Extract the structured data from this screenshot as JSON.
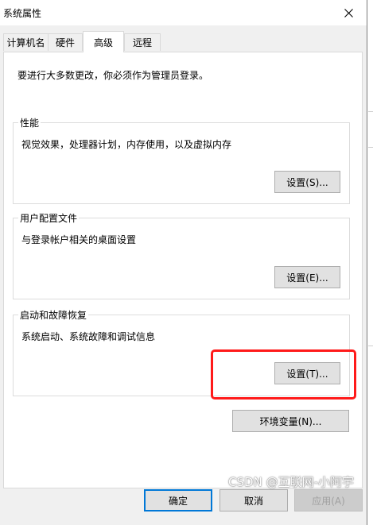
{
  "window": {
    "title": "系统属性"
  },
  "tabs": [
    {
      "label": "计算机名"
    },
    {
      "label": "硬件"
    },
    {
      "label": "高级"
    },
    {
      "label": "远程"
    }
  ],
  "advanced": {
    "intro": "要进行大多数更改，你必须作为管理员登录。",
    "performance": {
      "title": "性能",
      "description": "视觉效果，处理器计划，内存使用，以及虚拟内存",
      "button": "设置(S)..."
    },
    "user_profiles": {
      "title": "用户配置文件",
      "description": "与登录帐户相关的桌面设置",
      "button": "设置(E)..."
    },
    "startup_recovery": {
      "title": "启动和故障恢复",
      "description": "系统启动、系统故障和调试信息",
      "button": "设置(T)..."
    },
    "env_button": "环境变量(N)..."
  },
  "footer": {
    "ok": "确定",
    "cancel": "取消",
    "apply": "应用(A)"
  },
  "watermark": "CSDN @互联网-小阿宇",
  "colors": {
    "highlight": "#ff1a1a",
    "focus": "#0078d7"
  }
}
